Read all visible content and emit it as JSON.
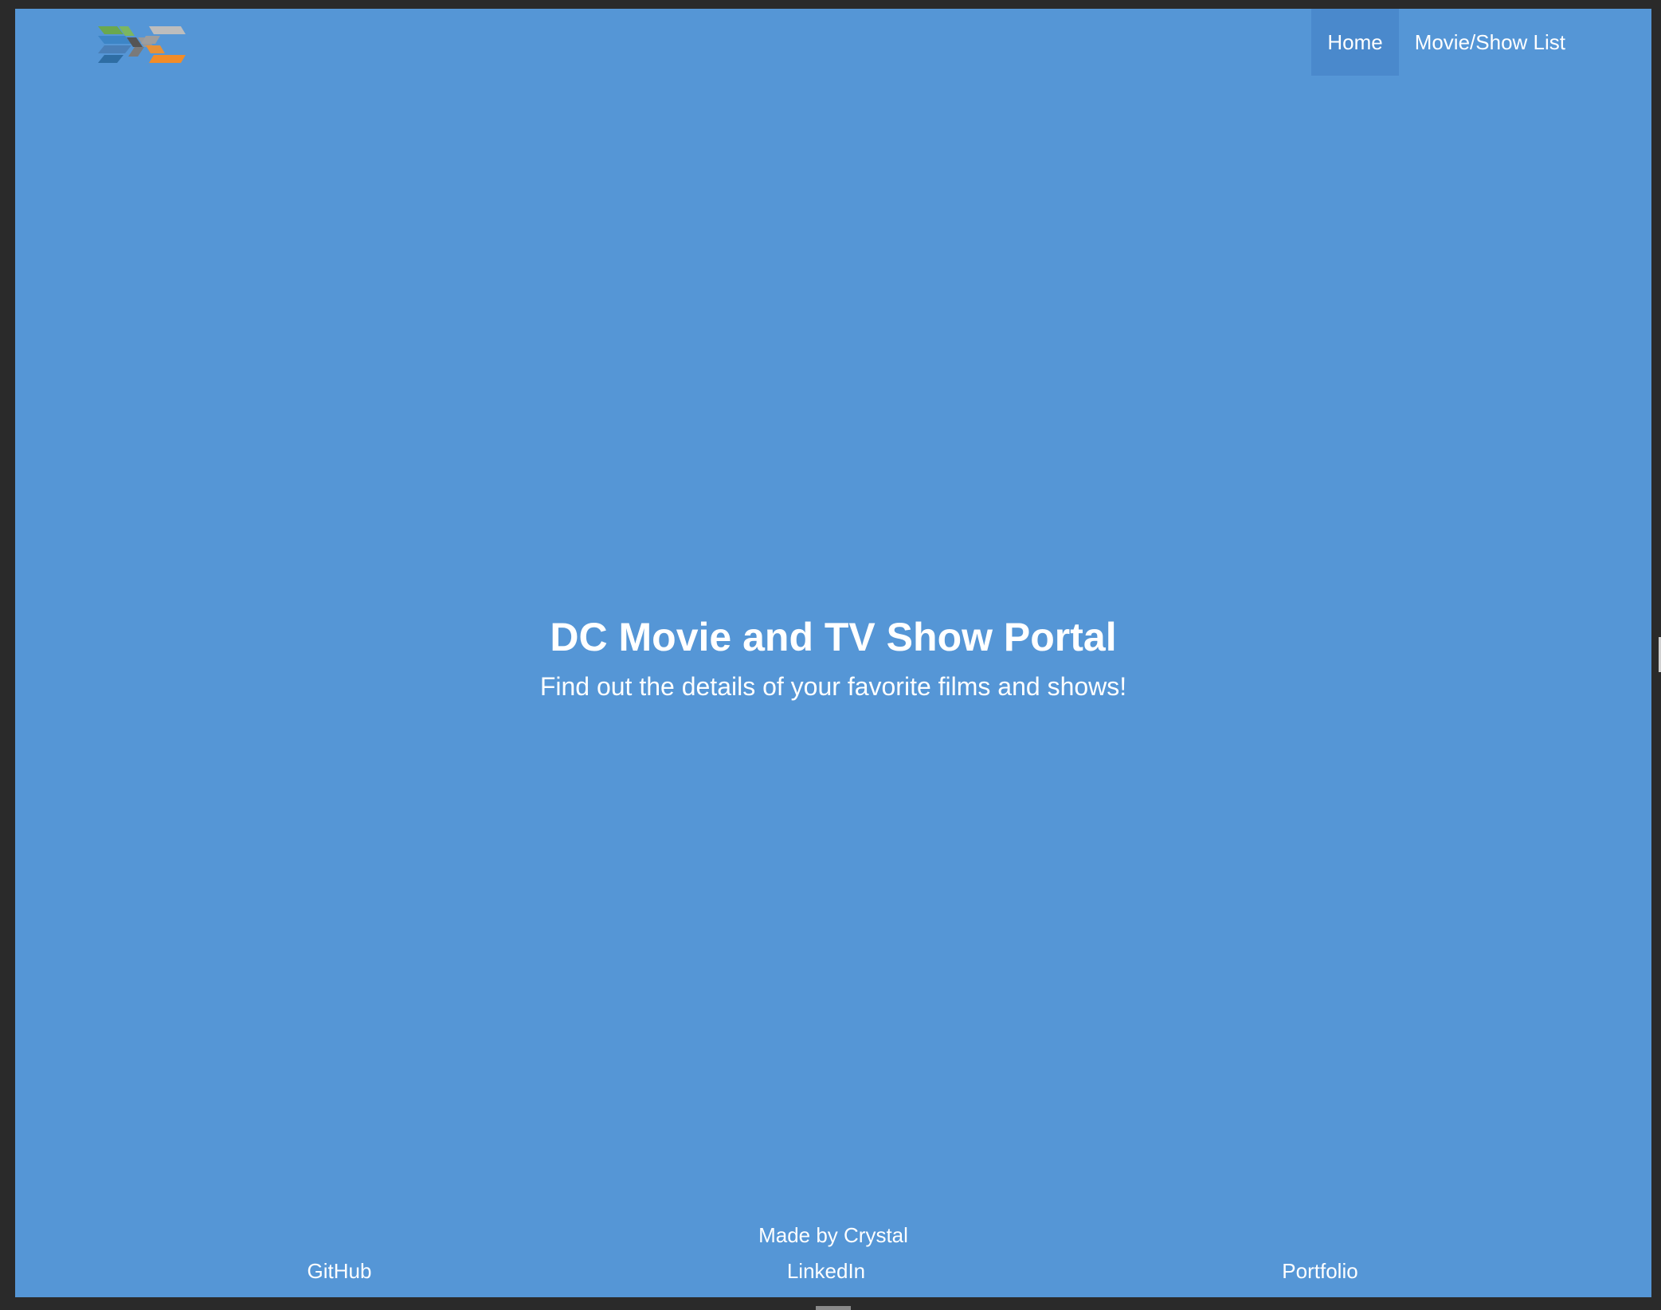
{
  "colors": {
    "page_background": "#5596d6",
    "nav_active": "#4a89cc",
    "frame": "#2a2a2a",
    "text": "#ffffff"
  },
  "logo": {
    "icon": "dc-logo"
  },
  "nav": {
    "items": [
      {
        "label": "Home",
        "active": true
      },
      {
        "label": "Movie/Show List",
        "active": false
      }
    ]
  },
  "hero": {
    "title": "DC Movie and TV Show Portal",
    "subtitle": "Find out the details of your favorite films and shows!"
  },
  "footer": {
    "credit": "Made by Crystal",
    "links": [
      {
        "label": "GitHub"
      },
      {
        "label": "LinkedIn"
      },
      {
        "label": "Portfolio"
      }
    ]
  }
}
